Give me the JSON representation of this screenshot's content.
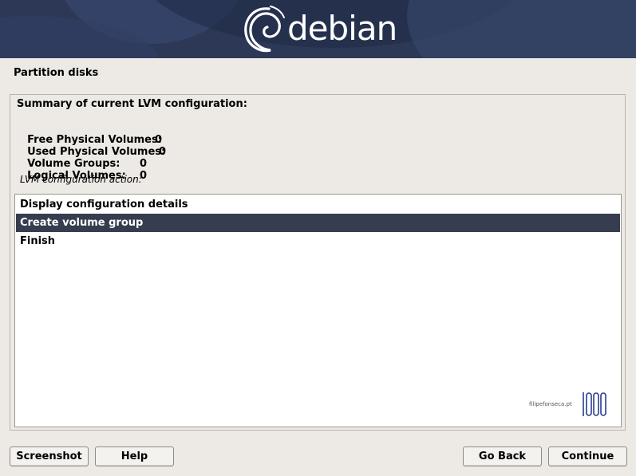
{
  "banner": {
    "logo_text": "debian"
  },
  "page_title": "Partition disks",
  "summary": {
    "title": "Summary of current LVM configuration:",
    "stats": [
      {
        "label": "Free Physical Volumes:",
        "value": "0"
      },
      {
        "label": "Used Physical Volumes:",
        "value": "0"
      },
      {
        "label": "Volume Groups:",
        "value": "0"
      },
      {
        "label": "Logical Volumes:",
        "value": "0"
      }
    ]
  },
  "action_label": "LVM configuration action:",
  "options": [
    {
      "label": "Display configuration details"
    },
    {
      "label": "Create volume group",
      "selected": true
    },
    {
      "label": "Finish"
    }
  ],
  "watermark": {
    "text": "filipefonseca.pt"
  },
  "buttons": {
    "screenshot": "Screenshot",
    "help": "Help",
    "go_back": "Go Back",
    "continue": "Continue"
  },
  "colors": {
    "banner": "#2c3856",
    "selection": "#363d4f",
    "background": "#edeae5"
  }
}
